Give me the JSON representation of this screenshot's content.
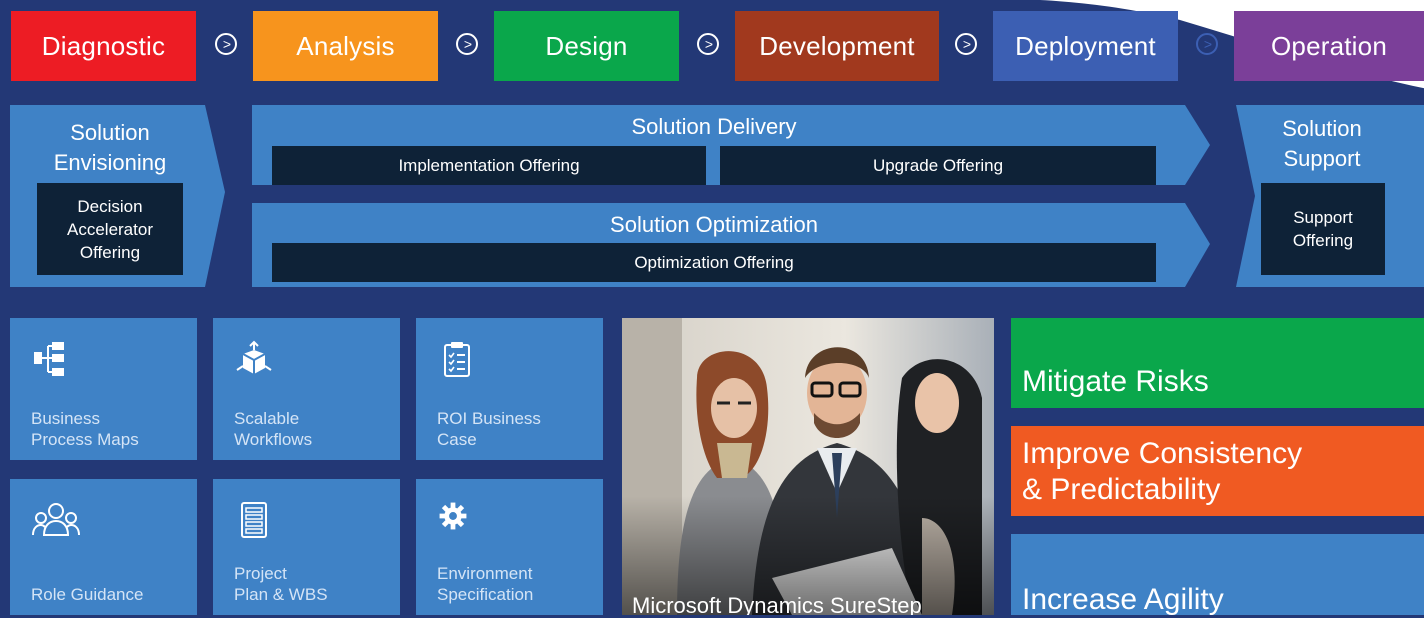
{
  "phases": [
    {
      "label": "Diagnostic",
      "color": "#ed1c24"
    },
    {
      "label": "Analysis",
      "color": "#f7941d"
    },
    {
      "label": "Design",
      "color": "#0aa74b"
    },
    {
      "label": "Development",
      "color": "#a1391e"
    },
    {
      "label": "Deployment",
      "color": "#3c5fb3"
    },
    {
      "label": "Operation",
      "color": "#7b3f99"
    }
  ],
  "envisioning": {
    "title_line1": "Solution",
    "title_line2": "Envisioning",
    "offer_line1": "Decision",
    "offer_line2": "Accelerator",
    "offer_line3": "Offering"
  },
  "delivery": {
    "title": "Solution Delivery",
    "offer1": "Implementation Offering",
    "offer2": "Upgrade Offering"
  },
  "optimization": {
    "title": "Solution Optimization",
    "offer": "Optimization Offering"
  },
  "support": {
    "title_line1": "Solution",
    "title_line2": "Support",
    "offer_line1": "Support",
    "offer_line2": "Offering"
  },
  "tiles": [
    {
      "line1": "Business",
      "line2": "Process Maps",
      "icon": "process-map-icon"
    },
    {
      "line1": "Scalable",
      "line2": "Workflows",
      "icon": "workflow-icon"
    },
    {
      "line1": "ROI Business",
      "line2": "Case",
      "icon": "clipboard-icon"
    },
    {
      "line1": "",
      "line2": "Role Guidance",
      "icon": "people-icon"
    },
    {
      "line1": "Project",
      "line2": "Plan & WBS",
      "icon": "plan-icon"
    },
    {
      "line1": "Environment",
      "line2": "Specification",
      "icon": "gear-icon"
    }
  ],
  "photo_caption": "Microsoft Dynamics SureStep",
  "benefits": [
    {
      "line1": "Mitigate Risks",
      "line2": "",
      "color": "#0aa74b"
    },
    {
      "line1": "Improve Consistency",
      "line2": "& Predictability",
      "color": "#f05a22"
    },
    {
      "line1": "Increase Agility",
      "line2": "",
      "color": "#3f82c6"
    }
  ],
  "colors": {
    "background": "#233876",
    "band": "#3f82c6",
    "dark_box": "#0e2237"
  }
}
